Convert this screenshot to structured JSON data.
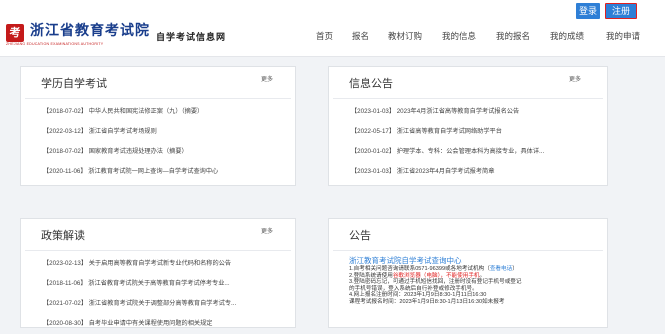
{
  "topbar": {
    "login_label": "登录",
    "register_label": "注册"
  },
  "header": {
    "logo_mark": "考",
    "title": "浙江省教育考试院",
    "title_en": "ZHEJIANG EDUCATION EXAMINATIONS AUTHORITY",
    "subtitle": "自学考试信息网"
  },
  "nav": [
    "首页",
    "报名",
    "教材订购",
    "我的信息",
    "我的报名",
    "我的成绩",
    "我的申请"
  ],
  "panels": {
    "academic": {
      "title": "学历自学考试",
      "more": "更多",
      "items": [
        "【2018-07-02】 中华人民共和国宪法修正案（九）（摘要）",
        "【2022-03-12】 浙江省自学考试考场规则",
        "【2018-07-02】 国家教育考试违规处理办法（摘要）",
        "【2020-11-06】 浙江教育考试院一网上查询—自学考试查询中心"
      ]
    },
    "info": {
      "title": "信息公告",
      "more": "更多",
      "items": [
        "【2023-01-03】 2023年4月浙江省高等教育自学考试报名公告",
        "【2022-05-17】 浙江省高等教育自学考试网络助学平台",
        "【2020-01-02】 护理学本、专科：公会管理本科为高接专业，具体详...",
        "【2023-01-03】 浙江省2023年4月自学考试报考简章"
      ]
    },
    "policy": {
      "title": "政策解读",
      "more": "更多",
      "items": [
        "【2023-02-13】 关于启用高等教育自学考试新专业代码和名称的公告",
        "【2018-11-06】 浙江省教育考试院关于高等教育自学考试停考专业...",
        "【2021-07-02】 浙江省教育考试院关于调整部分高等教育自学考试专...",
        "【2020-08-30】 自考毕业申请中有关课程使用问题的相关规定"
      ]
    },
    "notice": {
      "title": "公告",
      "link": "浙江教育考试院自学考试查询中心",
      "lines": [
        {
          "a": "1.自考相关问题咨询请联系0571-96399或各地考试机构（",
          "b": "查看电话",
          "c": "）",
          "b_color": "blue"
        },
        {
          "a": "2.登陆系统请使用",
          "b": "谷歌浏览器（电脑），不能使用手机",
          "c": "。",
          "b_color": "red"
        },
        {
          "a": "3.登陆密码忘记，可通过手机短信找回，注册时没有登记手机号或登记",
          "b": "",
          "c": "",
          "b_color": ""
        },
        {
          "a": "   的手机号错误，登入系统后自行补登或修改手机号。",
          "b": "",
          "c": "",
          "b_color": ""
        },
        {
          "a": "4.网上报名注册时间：2023年1月9日8:30-1月11日16:30",
          "b": "",
          "c": "",
          "b_color": ""
        },
        {
          "a": "   课程考试报名时间：2023年1月9日8:30-1月13日16:30如未报考",
          "b": "",
          "c": "",
          "b_color": ""
        }
      ]
    }
  }
}
